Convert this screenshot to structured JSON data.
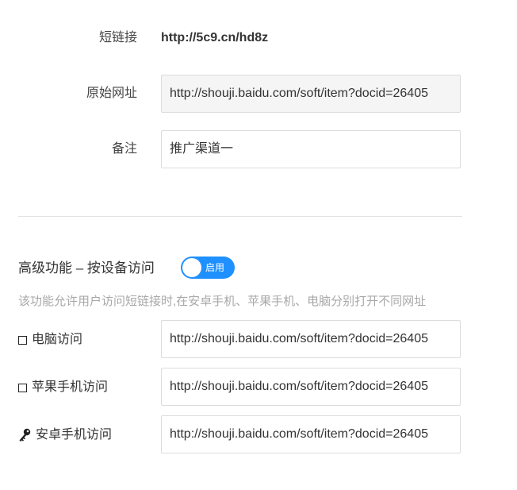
{
  "basic": {
    "short_link_label": "短链接",
    "short_link_value": "http://5c9.cn/hd8z",
    "original_url_label": "原始网址",
    "original_url_value": "http://shouji.baidu.com/soft/item?docid=26405",
    "note_label": "备注",
    "note_value": "推广渠道一"
  },
  "advanced": {
    "title": "高级功能 – 按设备访问",
    "toggle_label": "启用",
    "toggle_on": true,
    "hint": "该功能允许用户访问短链接时,在安卓手机、苹果手机、电脑分别打开不同网址",
    "rows": [
      {
        "label": "电脑访问",
        "icon": "checkbox-icon",
        "value": "http://shouji.baidu.com/soft/item?docid=26405"
      },
      {
        "label": "苹果手机访问",
        "icon": "checkbox-icon",
        "value": "http://shouji.baidu.com/soft/item?docid=26405"
      },
      {
        "label": "安卓手机访问",
        "icon": "key-icon",
        "value": "http://shouji.baidu.com/soft/item?docid=26405"
      }
    ]
  },
  "colors": {
    "toggle_bg": "#1e90ff",
    "hint_text": "#a8a8a8",
    "readonly_bg": "#f5f5f5"
  }
}
